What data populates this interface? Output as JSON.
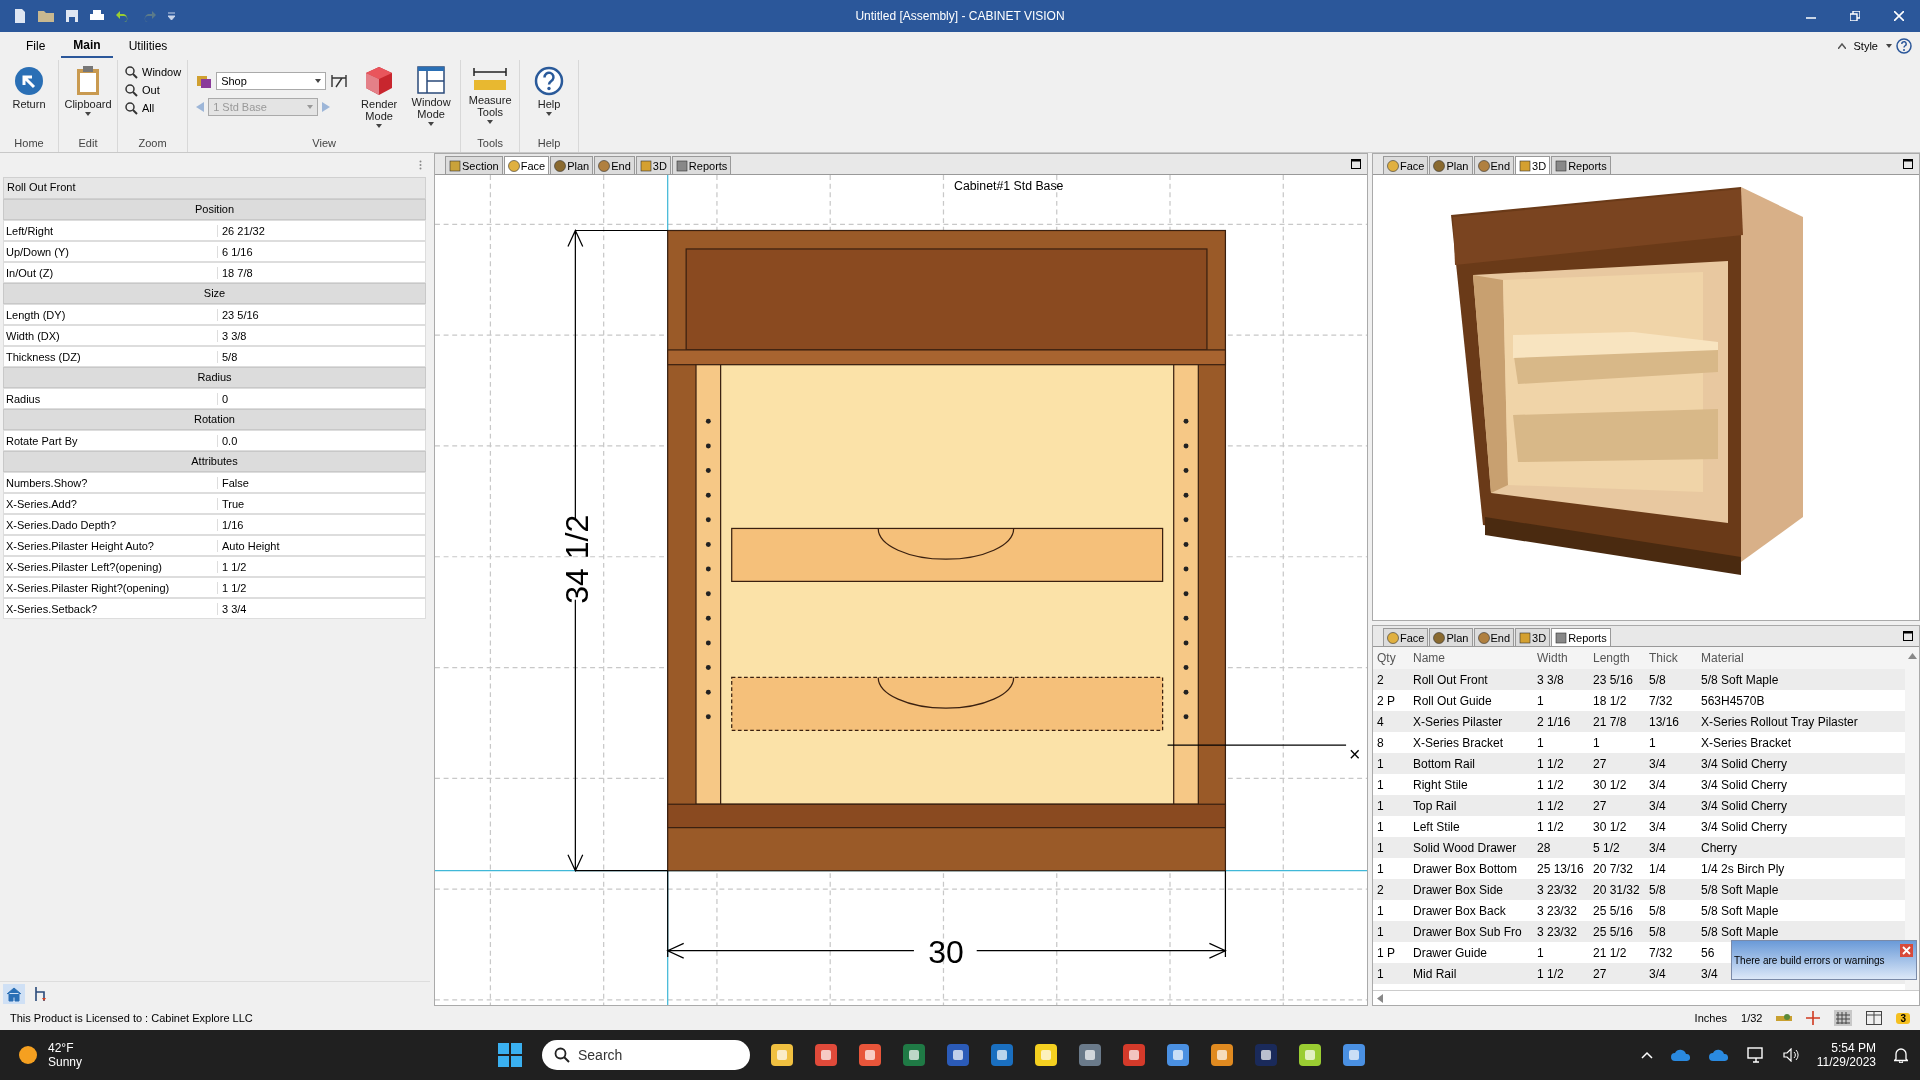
{
  "window": {
    "title": "Untitled [Assembly] - CABINET VISION"
  },
  "ribbon": {
    "tabs": [
      {
        "label": "File",
        "selected": false
      },
      {
        "label": "Main",
        "selected": true
      },
      {
        "label": "Utilities",
        "selected": false
      }
    ],
    "style_label": "Style",
    "groups": [
      {
        "label": "Home",
        "items": [
          {
            "label": "Return",
            "has_menu": false
          }
        ]
      },
      {
        "label": "Edit",
        "items": [
          {
            "label": "Clipboard",
            "has_menu": true
          }
        ]
      },
      {
        "label": "Zoom",
        "items": [
          {
            "label": "Window"
          },
          {
            "label": "Out"
          },
          {
            "label": "All"
          }
        ]
      },
      {
        "label": "View",
        "items": [
          {
            "label": "Render Mode",
            "has_menu": true
          },
          {
            "label": "Window Mode",
            "has_menu": true
          }
        ],
        "view_select": {
          "value": "Shop"
        },
        "item_select": {
          "value": "1 Std Base",
          "disabled": true
        }
      },
      {
        "label": "Tools",
        "items": [
          {
            "label": "Measure Tools",
            "has_menu": true
          }
        ]
      },
      {
        "label": "Help",
        "items": [
          {
            "label": "Help",
            "has_menu": true
          }
        ]
      }
    ]
  },
  "properties": {
    "title": "Roll Out Front",
    "sections": [
      {
        "heading": "Position",
        "rows": [
          {
            "label": "Left/Right",
            "value": "26 21/32"
          },
          {
            "label": "Up/Down (Y)",
            "value": "6 1/16"
          },
          {
            "label": "In/Out (Z)",
            "value": "18 7/8"
          }
        ]
      },
      {
        "heading": "Size",
        "rows": [
          {
            "label": "Length (DY)",
            "value": "23 5/16"
          },
          {
            "label": "Width (DX)",
            "value": "3 3/8"
          },
          {
            "label": "Thickness (DZ)",
            "value": "5/8"
          }
        ]
      },
      {
        "heading": "Radius",
        "rows": [
          {
            "label": "Radius",
            "value": "0"
          }
        ]
      },
      {
        "heading": "Rotation",
        "rows": [
          {
            "label": "Rotate Part By",
            "value": "0.0"
          }
        ]
      },
      {
        "heading": "Attributes",
        "rows": [
          {
            "label": "Numbers.Show?",
            "value": "False"
          },
          {
            "label": "X-Series.Add?",
            "value": "True"
          },
          {
            "label": "X-Series.Dado Depth?",
            "value": "1/16"
          },
          {
            "label": "X-Series.Pilaster Height Auto?",
            "value": "Auto Height"
          },
          {
            "label": "X-Series.Pilaster Left?(opening)",
            "value": "1 1/2"
          },
          {
            "label": "X-Series.Pilaster Right?(opening)",
            "value": "1 1/2"
          },
          {
            "label": "X-Series.Setback?",
            "value": "3 3/4"
          }
        ]
      }
    ]
  },
  "center_view": {
    "tabs": [
      {
        "label": "Section",
        "kind": "section",
        "selected": false
      },
      {
        "label": "Face",
        "kind": "face",
        "selected": true
      },
      {
        "label": "Plan",
        "kind": "plan",
        "selected": false
      },
      {
        "label": "End",
        "kind": "end",
        "selected": false
      },
      {
        "label": "3D",
        "kind": "box",
        "selected": false
      },
      {
        "label": "Reports",
        "kind": "reports",
        "selected": false
      }
    ],
    "title": "Cabinet#1 Std Base",
    "height_dim": "34 1/2",
    "width_dim": "30",
    "cross_mark": "×"
  },
  "view_3d": {
    "tabs": [
      {
        "label": "Face",
        "kind": "face",
        "selected": false
      },
      {
        "label": "Plan",
        "kind": "plan",
        "selected": false
      },
      {
        "label": "End",
        "kind": "end",
        "selected": false
      },
      {
        "label": "3D",
        "kind": "box",
        "selected": true
      },
      {
        "label": "Reports",
        "kind": "reports",
        "selected": false
      }
    ]
  },
  "reports": {
    "tabs": [
      {
        "label": "Face",
        "kind": "face",
        "selected": false
      },
      {
        "label": "Plan",
        "kind": "plan",
        "selected": false
      },
      {
        "label": "End",
        "kind": "end",
        "selected": false
      },
      {
        "label": "3D",
        "kind": "box",
        "selected": false
      },
      {
        "label": "Reports",
        "kind": "reports",
        "selected": true
      }
    ],
    "columns": [
      "Qty",
      "Name",
      "Width",
      "Length",
      "Thick",
      "Material"
    ],
    "rows": [
      [
        "2",
        "Roll Out Front",
        "3 3/8",
        "23 5/16",
        "5/8",
        "5/8 Soft Maple"
      ],
      [
        "2 P",
        "Roll Out Guide",
        "1",
        "18 1/2",
        "7/32",
        "563H4570B"
      ],
      [
        "4",
        "X-Series Pilaster",
        "2 1/16",
        "21 7/8",
        "13/16",
        "X-Series Rollout Tray Pilaster"
      ],
      [
        "8",
        "X-Series Bracket",
        "1",
        "1",
        "1",
        "X-Series Bracket"
      ],
      [
        "1",
        "Bottom Rail",
        "1 1/2",
        "27",
        "3/4",
        "3/4 Solid Cherry"
      ],
      [
        "1",
        "Right Stile",
        "1 1/2",
        "30 1/2",
        "3/4",
        "3/4 Solid Cherry"
      ],
      [
        "1",
        "Top Rail",
        "1 1/2",
        "27",
        "3/4",
        "3/4 Solid Cherry"
      ],
      [
        "1",
        "Left Stile",
        "1 1/2",
        "30 1/2",
        "3/4",
        "3/4 Solid Cherry"
      ],
      [
        "1",
        "Solid Wood Drawer",
        "28",
        "5 1/2",
        "3/4",
        "Cherry"
      ],
      [
        "1",
        "Drawer Box Bottom",
        "25 13/16",
        "20 7/32",
        "1/4",
        "1/4 2s Birch Ply"
      ],
      [
        "2",
        "Drawer Box Side",
        "3 23/32",
        "20 31/32",
        "5/8",
        "5/8 Soft Maple"
      ],
      [
        "1",
        "Drawer Box Back",
        "3 23/32",
        "25 5/16",
        "5/8",
        "5/8 Soft Maple"
      ],
      [
        "1",
        "Drawer Box Sub Fro",
        "3 23/32",
        "25 5/16",
        "5/8",
        "5/8 Soft Maple"
      ],
      [
        "1 P",
        "Drawer Guide",
        "1",
        "21 1/2",
        "7/32",
        "56"
      ],
      [
        "1",
        "Mid Rail",
        "1 1/2",
        "27",
        "3/4",
        "3/4"
      ]
    ],
    "toast": "There are build errors or warnings"
  },
  "status_bar": {
    "license": "This Product is Licensed to : Cabinet Explore LLC",
    "units": "Inches",
    "precision": "1/32",
    "warnings": "3"
  },
  "taskbar": {
    "temperature": "42°F",
    "weather": "Sunny",
    "search_placeholder": "Search",
    "time": "5:54 PM",
    "date": "11/29/2023"
  }
}
